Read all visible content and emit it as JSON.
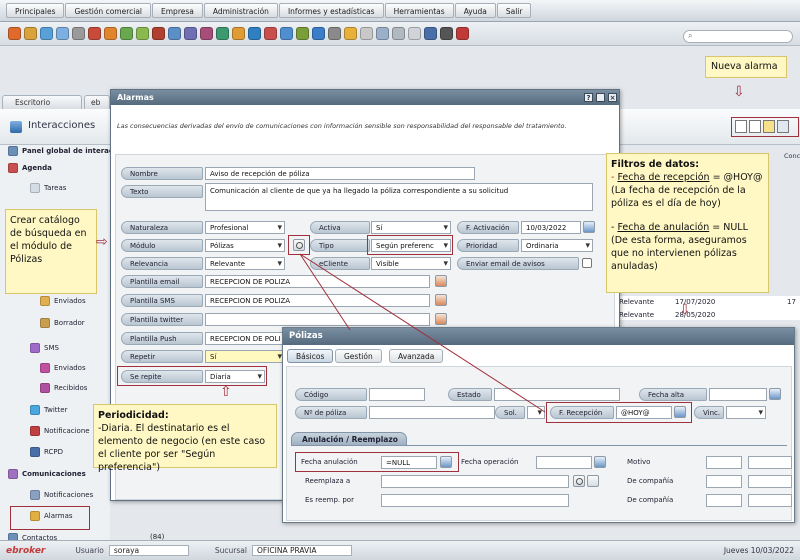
{
  "menu": [
    "Principales",
    "Gestión comercial",
    "Empresa",
    "Administración",
    "Informes y estadísticas",
    "Herramientas",
    "Ayuda",
    "Salir"
  ],
  "toolbar_icon_colors": [
    "#e06a2b",
    "#d9a23a",
    "#58a0d8",
    "#7db0e0",
    "#9a9a9a",
    "#c84a3a",
    "#e0852b",
    "#6aa84f",
    "#8aba4f",
    "#b0412e",
    "#5c8fc8",
    "#6f6fb3",
    "#a64d79",
    "#3d9970",
    "#e09b34",
    "#2f7fc1",
    "#c94f4f",
    "#4f8fd0",
    "#7a9e3a",
    "#3a7dc9",
    "#8a8a8a",
    "#e6b03a",
    "#c8c8c8",
    "#9ab0c8",
    "#b0b8c0",
    "#d0d4d8",
    "#4a6fa8",
    "#555",
    "#c03a3a"
  ],
  "tabs": {
    "escritorio": "Escritorio",
    "eb": "eb"
  },
  "header": {
    "title": "Interacciones"
  },
  "sidebar": {
    "panel": "Panel global de interacciones",
    "agenda": "Agenda",
    "tareas": "Tareas",
    "enviados": "Enviados",
    "borrador": "Borrador",
    "sms": "SMS",
    "sms_enviados": "Enviados",
    "sms_recibidos": "Recibidos",
    "twitter": "Twitter",
    "notificaciones_short": "Notificacione",
    "rcpd": "RCPD",
    "comunicaciones": "Comunicaciones",
    "notificaciones": "Notificaciones",
    "alarmas": "Alarmas",
    "contactos": "Contactos",
    "contactos_count": "(84)"
  },
  "alarmas": {
    "title": "Alarmas",
    "disclaimer": "Las consecuencias derivadas del envío de comunicaciones con información sensible son responsabilidad del responsable del tratamiento.",
    "labels": {
      "nombre": "Nombre",
      "texto": "Texto",
      "naturaleza": "Naturaleza",
      "modulo": "Módulo",
      "relevancia": "Relevancia",
      "plantilla_email": "Plantilla email",
      "plantilla_sms": "Plantilla SMS",
      "plantilla_twitter": "Plantilla twitter",
      "plantilla_push": "Plantilla Push",
      "repetir": "Repetir",
      "se_repite": "Se repite",
      "activa": "Activa",
      "tipo": "Tipo",
      "ecliente": "eCliente",
      "f_activacion": "F. Activación",
      "prioridad": "Prioridad",
      "enviar_email": "Enviar email de avisos"
    },
    "values": {
      "nombre": "Aviso de recepción de póliza",
      "texto": "Comunicación al cliente de que ya ha llegado la póliza correspondiente a su solicitud",
      "naturaleza": "Profesional",
      "modulo": "Pólizas",
      "relevancia": "Relevante",
      "plantilla_email": "RECEPCION DE POLIZA",
      "plantilla_sms": "RECEPCION DE POLIZA",
      "plantilla_twitter": "",
      "plantilla_push": "RECEPCION DE POLI",
      "repetir": "Sí",
      "se_repite": "Diaria",
      "activa": "Sí",
      "tipo": "Según preferenc",
      "ecliente": "Visible",
      "f_activacion": "10/03/2022",
      "prioridad": "Ordinaria"
    }
  },
  "right_table": {
    "header_col": "Concl",
    "rows": [
      {
        "a": "Relevante",
        "b": "17/07/2020",
        "c": "17"
      },
      {
        "a": "Relevante",
        "b": "28/05/2020",
        "c": ""
      }
    ]
  },
  "polizas": {
    "title": "Pólizas",
    "tabs": [
      "Básicos",
      "Gestión",
      "Avanzada"
    ],
    "labels": {
      "codigo": "Código",
      "estado": "Estado",
      "fecha_alta": "Fecha alta",
      "num_poliza": "Nº de póliza",
      "sol": "Sol.",
      "f_recepcion": "F. Recepción",
      "vinc": "Vinc.",
      "section": "Anulación / Reemplazo",
      "fecha_anulacion": "Fecha anulación",
      "fecha_operacion": "Fecha operación",
      "motivo": "Motivo",
      "reemplaza_a": "Reemplaza a",
      "de_compania": "De compañía",
      "es_reemp_por": "Es reemp. por",
      "de_compania2": "De compañía"
    },
    "values": {
      "f_recepcion": "@HOY@",
      "fecha_anulacion": "=NULL"
    }
  },
  "notes": {
    "nueva_alarma": "Nueva alarma",
    "catalogo": "Crear catálogo de búsqueda en el módulo de Pólizas",
    "filtros_title": "Filtros de datos:",
    "filtros_1_label": "Fecha de recepción",
    "filtros_1_rest": " = @HOY@ (La fecha de recepción de la póliza es el día de hoy)",
    "filtros_2_label": "Fecha de anulación",
    "filtros_2_rest": " = NULL (De esta forma, aseguramos que no intervienen pólizas anuladas)",
    "periodicidad_title": "Periodicidad:",
    "periodicidad_text": "-Diaria. El destinatario es el elemento de negocio (en este caso el cliente por ser \"Según preferencia\")"
  },
  "status": {
    "brand": "ebroker",
    "usuario_label": "Usuario",
    "usuario": "soraya",
    "sucursal_label": "Sucursal",
    "sucursal": "OFICINA PRAVIA",
    "date": "Jueves 10/03/2022"
  },
  "colors": {
    "accent_red": "#a0303c",
    "note_bg": "#fff8c4",
    "title_bar": "#566a7e"
  }
}
